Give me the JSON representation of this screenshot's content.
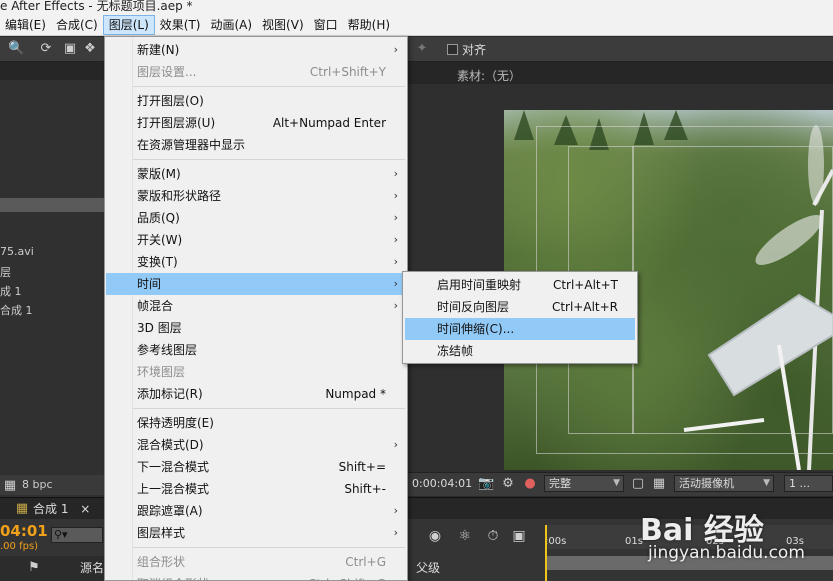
{
  "window": {
    "title": "e After Effects - 无标题项目.aep *"
  },
  "menubar": [
    {
      "label": "编辑(E)"
    },
    {
      "label": "合成(C)"
    },
    {
      "label": "图层(L)",
      "active": true
    },
    {
      "label": "效果(T)"
    },
    {
      "label": "动画(A)"
    },
    {
      "label": "视图(V)"
    },
    {
      "label": "窗口"
    },
    {
      "label": "帮助(H)"
    }
  ],
  "toolbar": {
    "align_label": "对齐"
  },
  "project_panel": {
    "items": [
      "75.avi",
      "层",
      "成 1",
      "合成 1"
    ],
    "bpc": "8 bpc"
  },
  "viewer": {
    "tab_label": "素材:（无）",
    "timecode": "0:00:04:01",
    "quality_select": "完整",
    "camera_select": "活动摄像机",
    "views_select": "1 ..."
  },
  "timeline": {
    "current_time": "04:01",
    "fps": ".00 fps)",
    "comp_tab": "合成 1",
    "source_column": "源名",
    "parent_column": "父级",
    "ruler": [
      ":00s",
      "01s",
      "02s",
      "03s"
    ]
  },
  "layer_menu": {
    "groups": [
      [
        {
          "label": "新建(N)",
          "submenu": true
        },
        {
          "label": "图层设置...",
          "shortcut": "Ctrl+Shift+Y",
          "disabled": true
        }
      ],
      [
        {
          "label": "打开图层(O)"
        },
        {
          "label": "打开图层源(U)",
          "shortcut": "Alt+Numpad Enter"
        },
        {
          "label": "在资源管理器中显示"
        }
      ],
      [
        {
          "label": "蒙版(M)",
          "submenu": true
        },
        {
          "label": "蒙版和形状路径",
          "submenu": true
        },
        {
          "label": "品质(Q)",
          "submenu": true
        },
        {
          "label": "开关(W)",
          "submenu": true
        },
        {
          "label": "变换(T)",
          "submenu": true
        },
        {
          "label": "时间",
          "submenu": true,
          "highlighted": true
        },
        {
          "label": "帧混合",
          "submenu": true
        },
        {
          "label": "3D 图层"
        },
        {
          "label": "参考线图层"
        },
        {
          "label": "环境图层",
          "disabled": true
        },
        {
          "label": "添加标记(R)",
          "shortcut": "Numpad *"
        }
      ],
      [
        {
          "label": "保持透明度(E)"
        },
        {
          "label": "混合模式(D)",
          "submenu": true
        },
        {
          "label": "下一混合模式",
          "shortcut": "Shift+="
        },
        {
          "label": "上一混合模式",
          "shortcut": "Shift+-"
        },
        {
          "label": "跟踪遮罩(A)",
          "submenu": true
        },
        {
          "label": "图层样式",
          "submenu": true
        }
      ],
      [
        {
          "label": "组合形状",
          "shortcut": "Ctrl+G",
          "disabled": true
        },
        {
          "label": "取消组合形状",
          "shortcut": "Ctrl+Shift+G",
          "disabled": true
        }
      ]
    ]
  },
  "time_submenu": [
    {
      "label": "启用时间重映射",
      "shortcut": "Ctrl+Alt+T"
    },
    {
      "label": "时间反向图层",
      "shortcut": "Ctrl+Alt+R"
    },
    {
      "label": "时间伸缩(C)...",
      "highlighted": true
    },
    {
      "label": "冻结帧"
    }
  ],
  "watermark": {
    "logo": "Bai 经验",
    "url": "jingyan.baidu.com"
  },
  "colors": {
    "menu_highlight": "#91c9f7",
    "timecode_orange": "#f0a019"
  }
}
